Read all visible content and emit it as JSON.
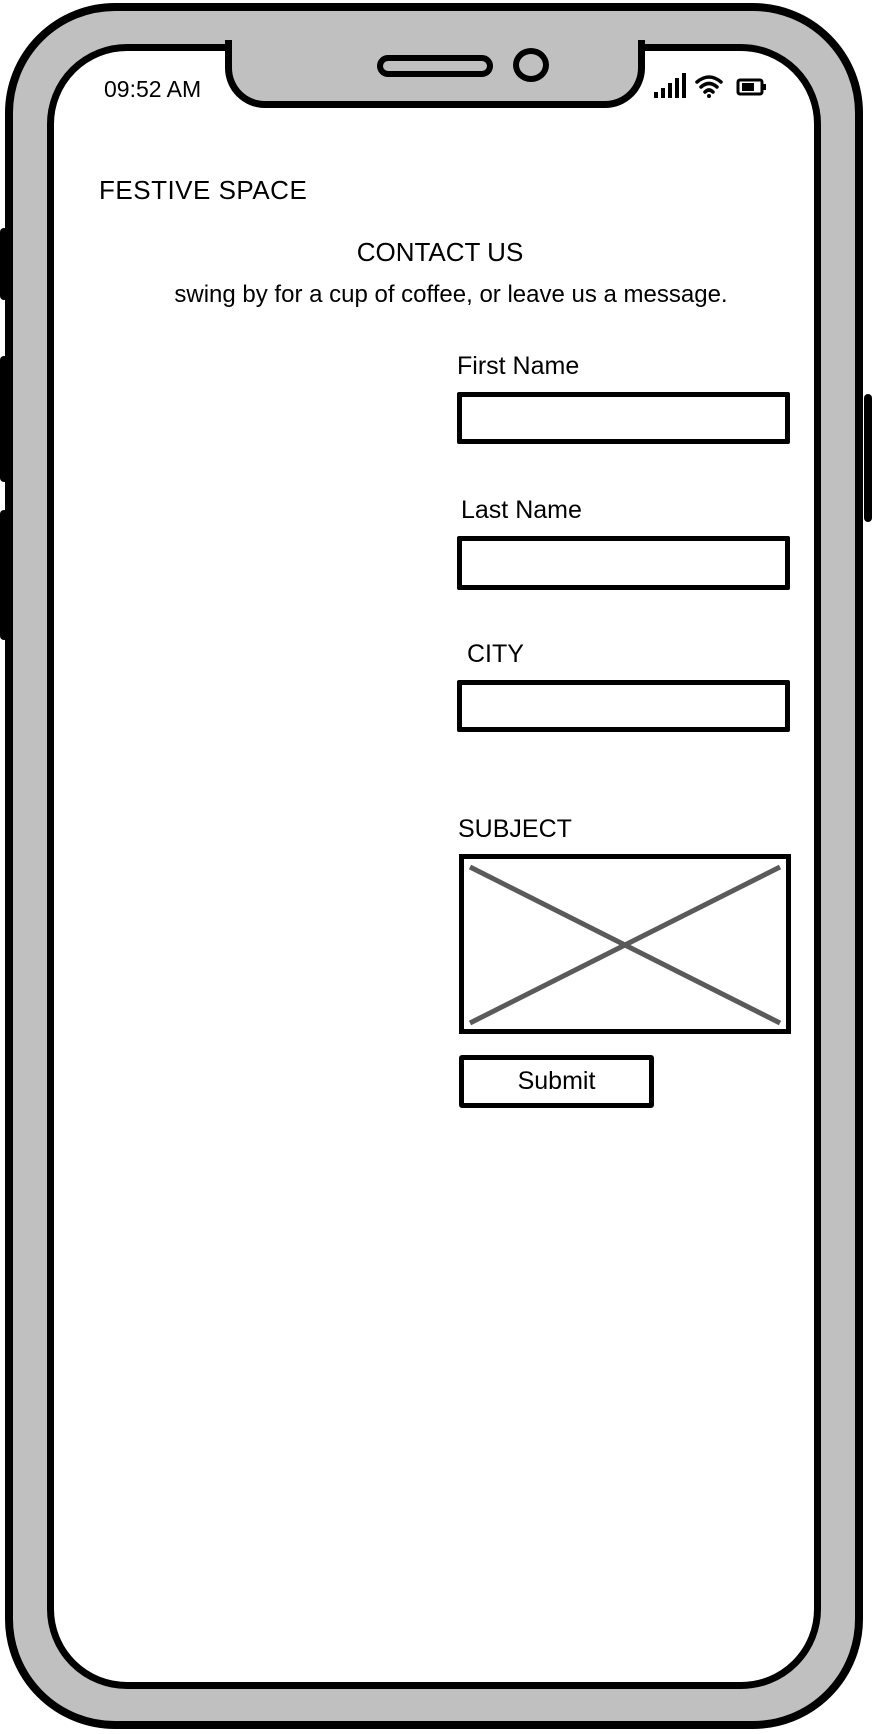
{
  "status_bar": {
    "time": "09:52 AM",
    "signal_icon": "signal-bars-icon",
    "wifi_icon": "wifi-icon",
    "battery_icon": "battery-icon"
  },
  "header": {
    "brand": "FESTIVE SPACE"
  },
  "contact": {
    "title": "CONTACT US",
    "subtitle": "swing by for a cup of coffee, or leave us a message."
  },
  "form": {
    "first_name_label": "First Name",
    "first_name_value": "",
    "last_name_label": "Last Name",
    "last_name_value": "",
    "city_label": "CITY",
    "city_value": "",
    "subject_label": "SUBJECT",
    "submit_label": "Submit"
  },
  "colors": {
    "frame": "#c0c0c0",
    "outline": "#000000",
    "placeholder_cross": "#5a5a5a"
  }
}
